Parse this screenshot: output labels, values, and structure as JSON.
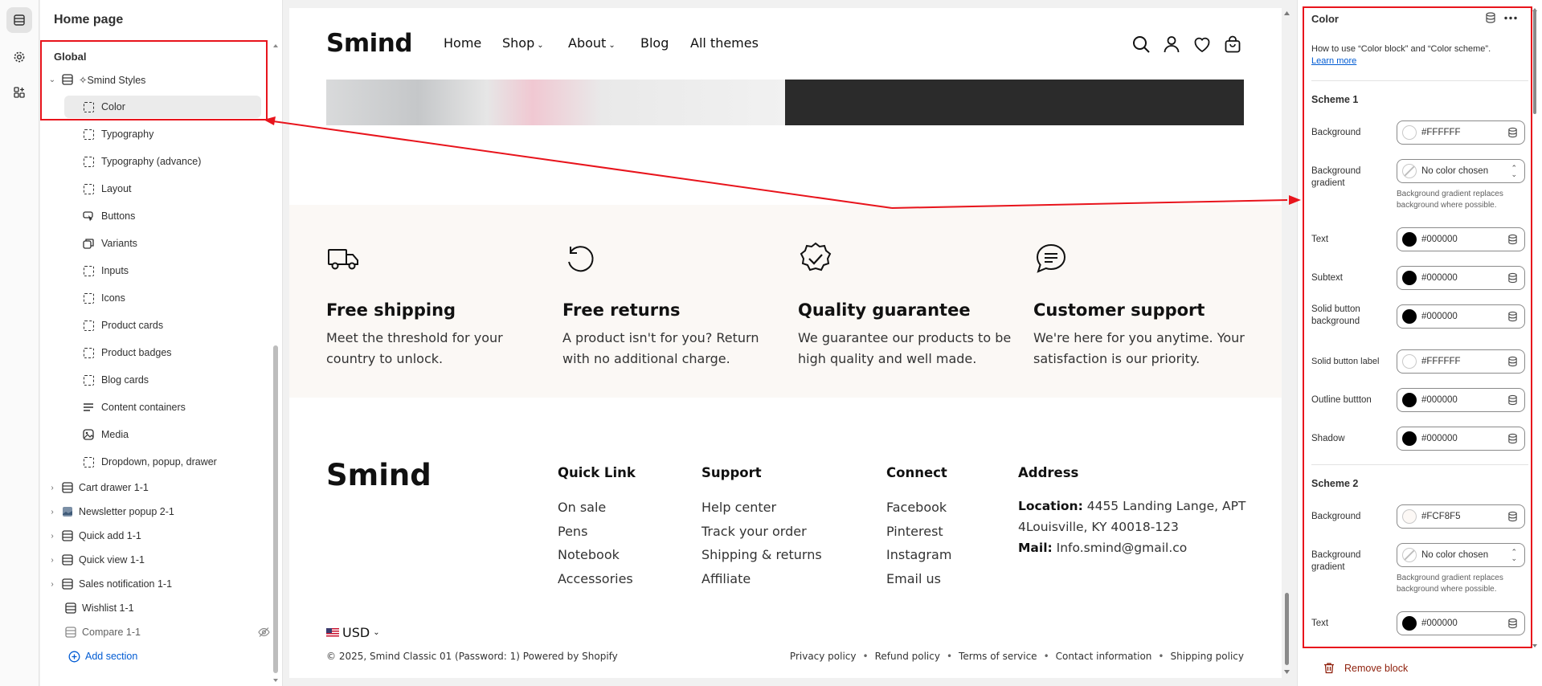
{
  "sidebar": {
    "title": "Home page",
    "global_label": "Global",
    "styles_label": "✧Smind Styles",
    "items": [
      {
        "label": "Color"
      },
      {
        "label": "Typography"
      },
      {
        "label": "Typography (advance)"
      },
      {
        "label": "Layout"
      },
      {
        "label": "Buttons"
      },
      {
        "label": "Variants"
      },
      {
        "label": "Inputs"
      },
      {
        "label": "Icons"
      },
      {
        "label": "Product cards"
      },
      {
        "label": "Product badges"
      },
      {
        "label": "Blog cards"
      },
      {
        "label": "Content containers"
      },
      {
        "label": "Media"
      },
      {
        "label": "Dropdown, popup, drawer"
      }
    ],
    "sections": [
      {
        "label": "Cart drawer 1-1"
      },
      {
        "label": "Newsletter popup 2-1"
      },
      {
        "label": "Quick add 1-1"
      },
      {
        "label": "Quick view 1-1"
      },
      {
        "label": "Sales notification 1-1"
      },
      {
        "label": "Wishlist 1-1"
      },
      {
        "label": "Compare 1-1"
      }
    ],
    "add_section": "Add section"
  },
  "preview": {
    "logo": "Smind",
    "nav": [
      "Home",
      "Shop",
      "About",
      "Blog",
      "All themes"
    ],
    "features": [
      {
        "title": "Free shipping",
        "desc_1": "Meet the threshold for your",
        "desc_2": "country to unlock."
      },
      {
        "title": "Free returns",
        "desc_1": "A product isn't for you? Return",
        "desc_2": "with no additional charge."
      },
      {
        "title": "Quality guarantee",
        "desc_1": "We guarantee our products to be",
        "desc_2": "high quality and well made."
      },
      {
        "title": "Customer support",
        "desc_1": "We're here for you anytime. Your",
        "desc_2": "satisfaction is our priority."
      }
    ],
    "footer": {
      "logo": "Smind",
      "quick_link": {
        "heading": "Quick Link",
        "links": [
          "On sale",
          "Pens",
          "Notebook",
          "Accessories"
        ]
      },
      "support": {
        "heading": "Support",
        "links": [
          "Help center",
          "Track your order",
          "Shipping & returns",
          "Affiliate"
        ]
      },
      "connect": {
        "heading": "Connect",
        "links": [
          "Facebook",
          "Pinterest",
          "Instagram",
          "Email us"
        ]
      },
      "address": {
        "heading": "Address",
        "location_label": "Location:",
        "location_value_1": "4455 Landing Lange, APT",
        "location_value_2": "4Louisville, KY 40018-123",
        "mail_label": "Mail:",
        "mail_value": "Info.smind@gmail.co"
      },
      "currency": "USD",
      "copyright": "© 2025, Smind Classic 01 (Password: 1) Powered by Shopify",
      "policies": [
        "Privacy policy",
        "Refund policy",
        "Terms of service",
        "Contact information",
        "Shipping policy"
      ]
    }
  },
  "panel": {
    "title": "Color",
    "help_text": "How to use “Color block” and “Color scheme”.",
    "help_link": "Learn more",
    "scheme1": {
      "title": "Scheme 1",
      "background_label": "Background",
      "background_value": "#FFFFFF",
      "gradient_label": "Background gradient",
      "gradient_value": "No color chosen",
      "gradient_hint": "Background gradient replaces background where possible.",
      "text_label": "Text",
      "text_value": "#000000",
      "subtext_label": "Subtext",
      "subtext_value": "#000000",
      "solid_bg_label": "Solid button background",
      "solid_bg_value": "#000000",
      "solid_label_label": "Solid button label",
      "solid_label_value": "#FFFFFF",
      "outline_label": "Outline buttton",
      "outline_value": "#000000",
      "shadow_label": "Shadow",
      "shadow_value": "#000000"
    },
    "scheme2": {
      "title": "Scheme 2",
      "background_label": "Background",
      "background_value": "#FCF8F5",
      "gradient_label": "Background gradient",
      "gradient_value": "No color chosen",
      "gradient_hint": "Background gradient replaces background where possible.",
      "text_label": "Text",
      "text_value": "#000000"
    },
    "remove_block": "Remove block"
  },
  "colors": {
    "annotation_red": "#e8141c",
    "swatch_white": "#FFFFFF",
    "swatch_black": "#000000",
    "swatch_cream": "#FCF8F5",
    "feature_band": "#fbf8f5",
    "link_blue": "#005bd3",
    "danger": "#8e1f0b"
  },
  "icons": {
    "rail": [
      "sections-icon",
      "settings-gear-icon",
      "apps-icon"
    ],
    "header": [
      "search-icon",
      "account-icon",
      "wishlist-heart-icon",
      "cart-bag-icon"
    ],
    "features": [
      "truck-icon",
      "return-arrow-icon",
      "badge-check-icon",
      "chat-bubble-icon"
    ]
  }
}
